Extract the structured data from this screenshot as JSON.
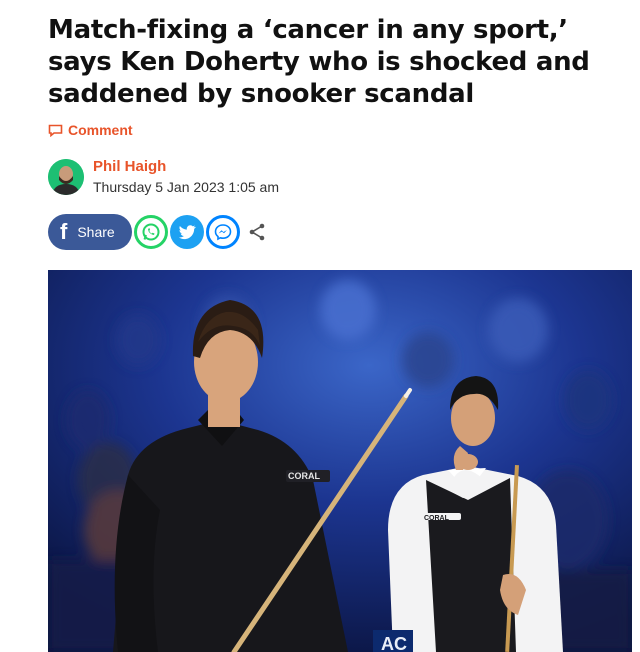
{
  "article": {
    "headline": "Match-fixing a ‘cancer in any sport,’ says Ken Doherty who is shocked and saddened by snooker scandal",
    "comment_label": "Comment",
    "author_name": "Phil Haigh",
    "date": "Thursday 5 Jan 2023 1:05 am"
  },
  "share": {
    "facebook_label": "Share",
    "icons": [
      "facebook-icon",
      "whatsapp-icon",
      "twitter-icon",
      "messenger-icon",
      "share-icon"
    ]
  },
  "photo": {
    "jersey_text_left": "CORAL",
    "jersey_text_right": "CORAL",
    "sign_text": "AC"
  },
  "colors": {
    "accent": "#e8542a",
    "facebook": "#3b5998",
    "whatsapp": "#25d366",
    "twitter": "#1da1f2",
    "messenger": "#0084ff"
  }
}
